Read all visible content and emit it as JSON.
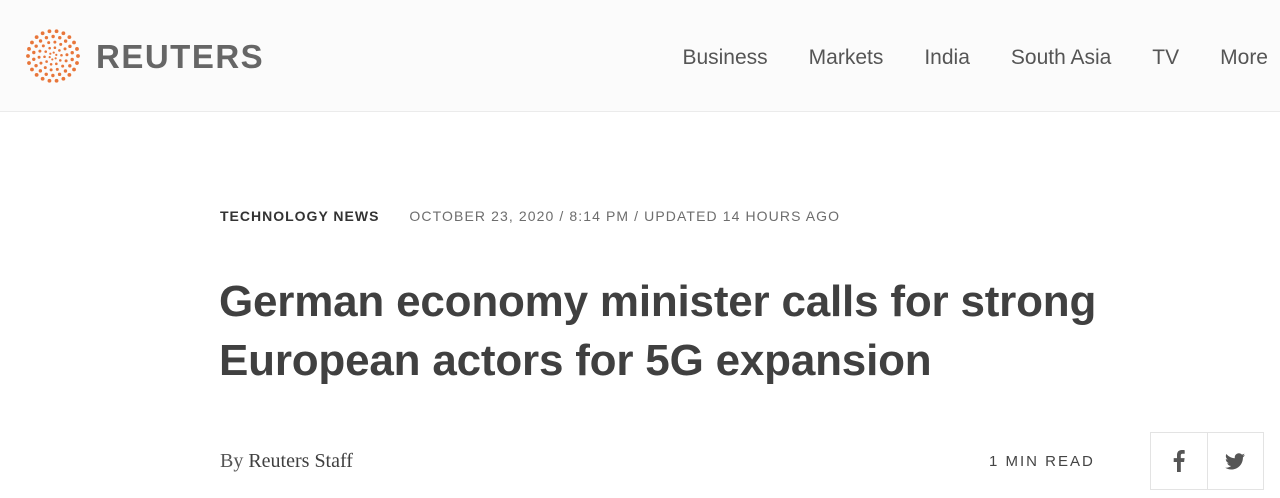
{
  "header": {
    "logo_text": "REUTERS",
    "logo_icon": "reuters-dot-circle-icon",
    "brand_color": "#e8763a",
    "nav": [
      {
        "label": "Business"
      },
      {
        "label": "Markets"
      },
      {
        "label": "India"
      },
      {
        "label": "South Asia"
      },
      {
        "label": "TV"
      },
      {
        "label": "More"
      }
    ]
  },
  "article": {
    "section": "TECHNOLOGY NEWS",
    "dateline": "OCTOBER 23, 2020 / 8:14 PM / UPDATED 14 HOURS AGO",
    "headline": "German economy minister calls for strong European actors for 5G expansion",
    "byline_prefix": "By",
    "author": "Reuters Staff",
    "read_time": "1 MIN READ"
  },
  "share": {
    "facebook_icon": "facebook-icon",
    "twitter_icon": "twitter-icon"
  }
}
